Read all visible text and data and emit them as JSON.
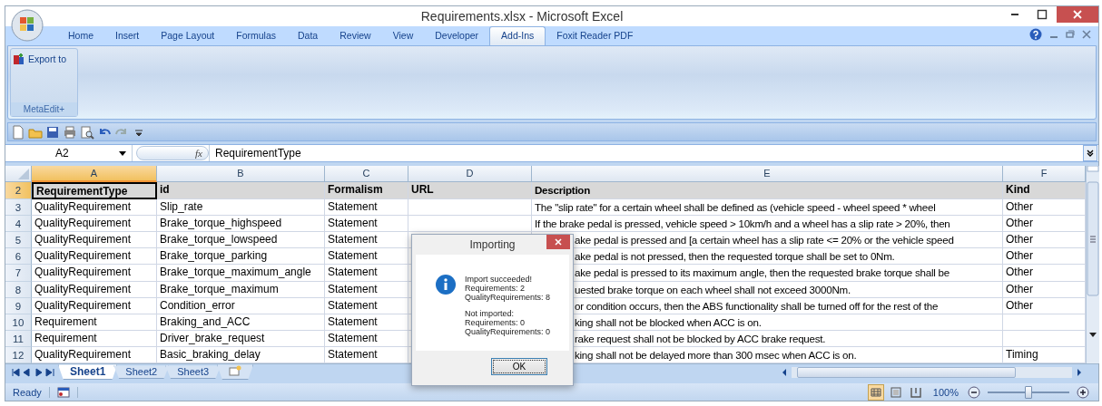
{
  "window": {
    "title": "Requirements.xlsx - Microsoft Excel"
  },
  "ribbon": {
    "tabs": [
      {
        "label": "Home",
        "selected": false
      },
      {
        "label": "Insert",
        "selected": false
      },
      {
        "label": "Page Layout",
        "selected": false
      },
      {
        "label": "Formulas",
        "selected": false
      },
      {
        "label": "Data",
        "selected": false
      },
      {
        "label": "Review",
        "selected": false
      },
      {
        "label": "View",
        "selected": false
      },
      {
        "label": "Developer",
        "selected": false
      },
      {
        "label": "Add-Ins",
        "selected": true
      },
      {
        "label": "Foxit Reader PDF",
        "selected": false
      }
    ],
    "button": "Export to",
    "group": "MetaEdit+"
  },
  "formula_bar": {
    "name_box": "A2",
    "function_label": "fx",
    "formula": "RequirementType"
  },
  "sheet": {
    "columns": [
      {
        "label": "A",
        "selected": true
      },
      {
        "label": "B",
        "selected": false
      },
      {
        "label": "C",
        "selected": false
      },
      {
        "label": "D",
        "selected": false
      },
      {
        "label": "E",
        "selected": false
      },
      {
        "label": "F",
        "selected": false
      }
    ],
    "rows": [
      {
        "number": "2",
        "kind": "header",
        "selected": true,
        "cells": [
          "RequirementType",
          "id",
          "Formalism",
          "URL",
          "Description",
          "Kind"
        ]
      },
      {
        "number": "3",
        "kind": "data",
        "selected": false,
        "cells": [
          "QualityRequirement",
          "Slip_rate",
          "Statement",
          "",
          "The \"slip rate\" for a certain wheel shall be defined as (vehicle speed - wheel speed * wheel",
          "Other"
        ]
      },
      {
        "number": "4",
        "kind": "data",
        "selected": false,
        "cells": [
          "QualityRequirement",
          "Brake_torque_highspeed",
          "Statement",
          "",
          "If the brake pedal is pressed, vehicle speed > 10km/h and a wheel has a slip rate > 20%, then",
          "Other"
        ]
      },
      {
        "number": "5",
        "kind": "data",
        "selected": false,
        "cells": [
          "QualityRequirement",
          "Brake_torque_lowspeed",
          "Statement",
          "",
          "ake pedal is pressed and [a certain wheel has a slip rate <= 20% or the vehicle speed",
          "Other"
        ]
      },
      {
        "number": "6",
        "kind": "data",
        "selected": false,
        "cells": [
          "QualityRequirement",
          "Brake_torque_parking",
          "Statement",
          "",
          "ake pedal is not pressed, then the requested torque shall be set to 0Nm.",
          "Other"
        ]
      },
      {
        "number": "7",
        "kind": "data",
        "selected": false,
        "cells": [
          "QualityRequirement",
          "Brake_torque_maximum_angle",
          "Statement",
          "",
          "ake pedal is pressed to its maximum angle, then the requested brake torque shall be",
          "Other"
        ]
      },
      {
        "number": "8",
        "kind": "data",
        "selected": false,
        "cells": [
          "QualityRequirement",
          "Brake_torque_maximum",
          "Statement",
          "",
          "uested brake torque on each wheel shall not exceed 3000Nm.",
          "Other"
        ]
      },
      {
        "number": "9",
        "kind": "data",
        "selected": false,
        "cells": [
          "QualityRequirement",
          "Condition_error",
          "Statement",
          "",
          "or condition occurs, then the ABS functionality shall be turned off for the rest of the",
          "Other"
        ]
      },
      {
        "number": "10",
        "kind": "data",
        "selected": false,
        "cells": [
          "Requirement",
          "Braking_and_ACC",
          "Statement",
          "",
          "king shall not be blocked when ACC is on.",
          ""
        ]
      },
      {
        "number": "11",
        "kind": "data",
        "selected": false,
        "cells": [
          "Requirement",
          "Driver_brake_request",
          "Statement",
          "",
          "rake request shall not be blocked by ACC brake request.",
          ""
        ]
      },
      {
        "number": "12",
        "kind": "data",
        "selected": false,
        "cells": [
          "QualityRequirement",
          "Basic_braking_delay",
          "Statement",
          "",
          "king shall not be delayed more than 300 msec when ACC is on.",
          "Timing"
        ]
      }
    ]
  },
  "sheet_tabs": [
    {
      "label": "Sheet1",
      "selected": true
    },
    {
      "label": "Sheet2",
      "selected": false
    },
    {
      "label": "Sheet3",
      "selected": false
    }
  ],
  "dialog": {
    "title": "Importing",
    "paragraphs": [
      [
        "Import succeeded!",
        "Requirements: 2",
        "QualityRequirements: 8"
      ],
      [
        "Not imported:",
        "Requirements: 0",
        "QualityRequirements: 0"
      ]
    ],
    "button": "OK"
  },
  "status_bar": {
    "status": "Ready",
    "views": [
      {
        "kind": "normal",
        "selected": true
      },
      {
        "kind": "layout",
        "selected": false
      },
      {
        "kind": "break",
        "selected": false
      }
    ],
    "zoom": "100%",
    "zoom_slider": {
      "level": 0.5
    }
  }
}
